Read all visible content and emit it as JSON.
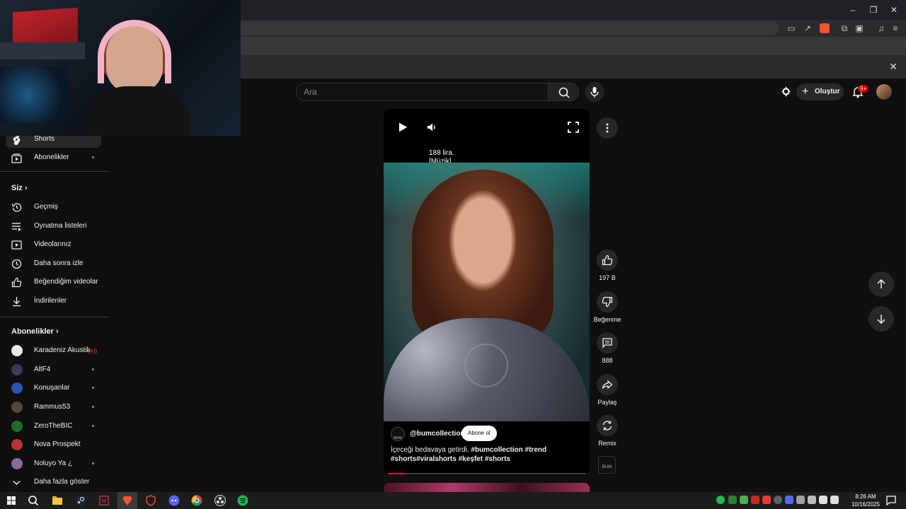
{
  "browser": {
    "window_controls": [
      "–",
      "❐",
      "✕"
    ]
  },
  "youtube": {
    "search": {
      "placeholder": "Ara"
    },
    "create_label": "Oluştur",
    "notifications_badge": "9+"
  },
  "sidebar": {
    "items_top": [
      {
        "label": "Shorts",
        "icon": "shorts-icon",
        "active": true
      },
      {
        "label": "Abonelikler",
        "icon": "subscriptions-icon",
        "dot": true
      }
    ],
    "you_heading": "Siz",
    "you_items": [
      {
        "label": "Geçmiş",
        "icon": "history-icon"
      },
      {
        "label": "Oynatma listeleri",
        "icon": "playlist-icon"
      },
      {
        "label": "Videolarınız",
        "icon": "your-videos-icon"
      },
      {
        "label": "Daha sonra izle",
        "icon": "watch-later-icon"
      },
      {
        "label": "Beğendiğim videolar",
        "icon": "liked-icon"
      },
      {
        "label": "İndirilenler",
        "icon": "download-icon"
      }
    ],
    "subs_heading": "Abonelikler",
    "subscriptions": [
      {
        "label": "Karadeniz Akustik",
        "live": true,
        "color": "#e8e8e8"
      },
      {
        "label": "AltF4",
        "dot": true,
        "color": "#3b3b5c"
      },
      {
        "label": "Konuşanlar",
        "dot": true,
        "color": "#3052b5"
      },
      {
        "label": "Rammus53",
        "dot": true,
        "color": "#5a4636"
      },
      {
        "label": "ZeroTheBIC",
        "dot": true,
        "color": "#1d6b2a"
      },
      {
        "label": "Nova Prospekt",
        "dot": false,
        "color": "#b8323a"
      },
      {
        "label": "Noluyo Ya ¿",
        "dot": true,
        "color": "#8a6a9a"
      }
    ],
    "show_more": "Daha fazla göster"
  },
  "short": {
    "caption_line1": "188 lira.",
    "caption_line2": "[Müzik]",
    "channel_logo_text": "BUM",
    "channel": "@bumcollection",
    "subscribe": "Abone ol",
    "desc_text": "İçeceği bedavaya getirdi.",
    "desc_tags_1": "#bumcollection #trend",
    "desc_tags_2": "#shorts#viralshorts #keşfet #shorts",
    "progress": 0.09
  },
  "actions": {
    "likes": "197 B",
    "dislike": "Beğenme",
    "comments": "888",
    "share": "Paylaş",
    "remix": "Remix"
  },
  "taskbar": {
    "time": "8:26 AM",
    "date": "10/16/2025"
  },
  "colors": {
    "accent": "#3ea6ff",
    "brand_red": "#ff0033",
    "spotify": "#1db954"
  }
}
